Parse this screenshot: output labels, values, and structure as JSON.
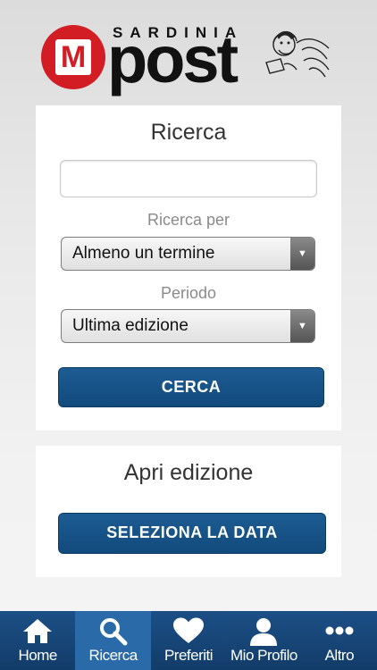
{
  "header": {
    "logo_m": "M",
    "logo_sardinia": "SARDINIA",
    "logo_post": "post"
  },
  "search": {
    "title": "Ricerca",
    "input_value": "",
    "input_placeholder": "",
    "search_by_label": "Ricerca per",
    "search_by_value": "Almeno un termine",
    "period_label": "Periodo",
    "period_value": "Ultima edizione",
    "submit_label": "CERCA"
  },
  "edition": {
    "title": "Apri edizione",
    "select_date_label": "SELEZIONA LA DATA"
  },
  "tabbar": {
    "active_tab": "Ricerca",
    "tabs": [
      {
        "label": "Home",
        "icon": "home-icon"
      },
      {
        "label": "Ricerca",
        "icon": "search-icon"
      },
      {
        "label": "Preferiti",
        "icon": "heart-icon"
      },
      {
        "label": "Mio Profilo",
        "icon": "user-icon"
      },
      {
        "label": "Altro",
        "icon": "more-icon"
      }
    ]
  },
  "colors": {
    "brand_red": "#d21d24",
    "button_blue": "#1a5a8f",
    "tabbar_blue": "#17457a",
    "tab_active_blue": "#2a6aa8"
  }
}
